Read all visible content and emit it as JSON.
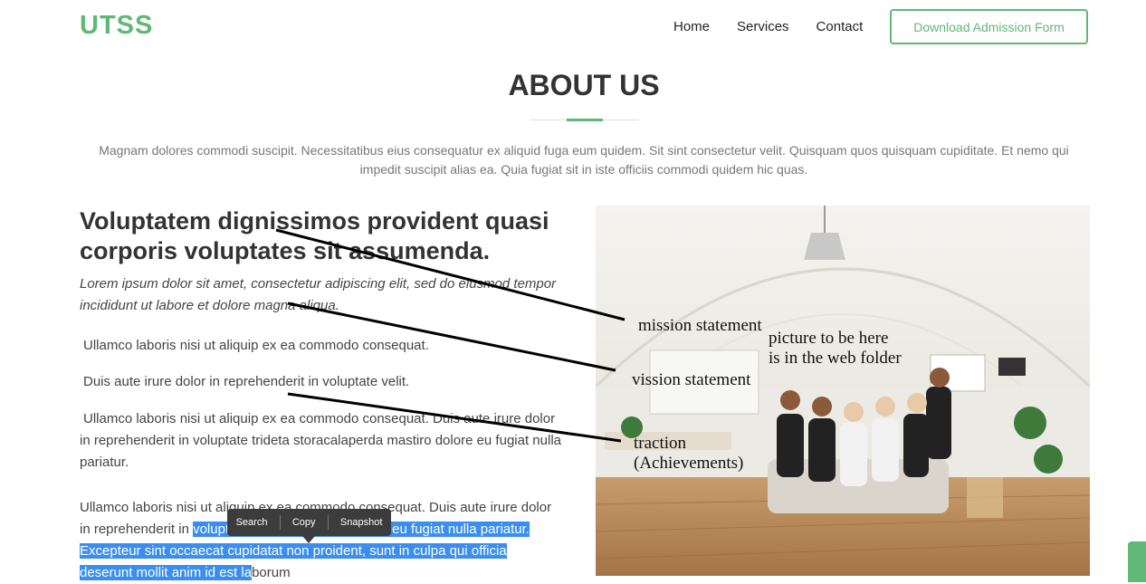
{
  "brand": "UTSS",
  "nav": {
    "items": [
      "Home",
      "Services",
      "Contact"
    ],
    "download_label": "Download Admission Form"
  },
  "about": {
    "title": "ABOUT US",
    "intro": "Magnam dolores commodi suscipit. Necessitatibus eius consequatur ex aliquid fuga eum quidem. Sit sint consectetur velit. Quisquam quos quisquam cupiditate. Et nemo qui impedit suscipit alias ea. Quia fugiat sit in iste officiis commodi quidem hic quas.",
    "heading": "Voluptatem dignissimos provident quasi corporis voluptates sit assumenda.",
    "lead": "Lorem ipsum dolor sit amet, consectetur adipiscing elit, sed do eiusmod tempor incididunt ut labore et dolore magna aliqua.",
    "p1": "Ullamco laboris nisi ut aliquip ex ea commodo consequat.",
    "p2": "Duis aute irure dolor in reprehenderit in voluptate velit.",
    "p3": "Ullamco laboris nisi ut aliquip ex ea commodo consequat. Duis aute irure dolor in reprehenderit in voluptate trideta storacalaperda mastiro dolore eu fugiat nulla pariatur.",
    "p4_a": "Ullamco laboris nisi ut aliquip ex ea commodo consequat. Duis aute irure dolor in reprehenderit in ",
    "p4_b": "voluptate velit esse cillum dolore eu fugiat nulla pariatur. Excepteur sint occaecat cupidatat non proident, sunt in culpa qui officia deserunt mollit anim id est la",
    "p4_c": "borum"
  },
  "context_menu": {
    "search": "Search",
    "copy": "Copy",
    "snapshot": "Snapshot"
  },
  "annotations": {
    "mission": "mission statement",
    "picture": "picture to be here\nis in the web folder",
    "vission": "vission statement",
    "traction": "traction\n(Achievements)"
  },
  "colors": {
    "accent": "#5fb876",
    "selection": "#3b8ef0"
  }
}
